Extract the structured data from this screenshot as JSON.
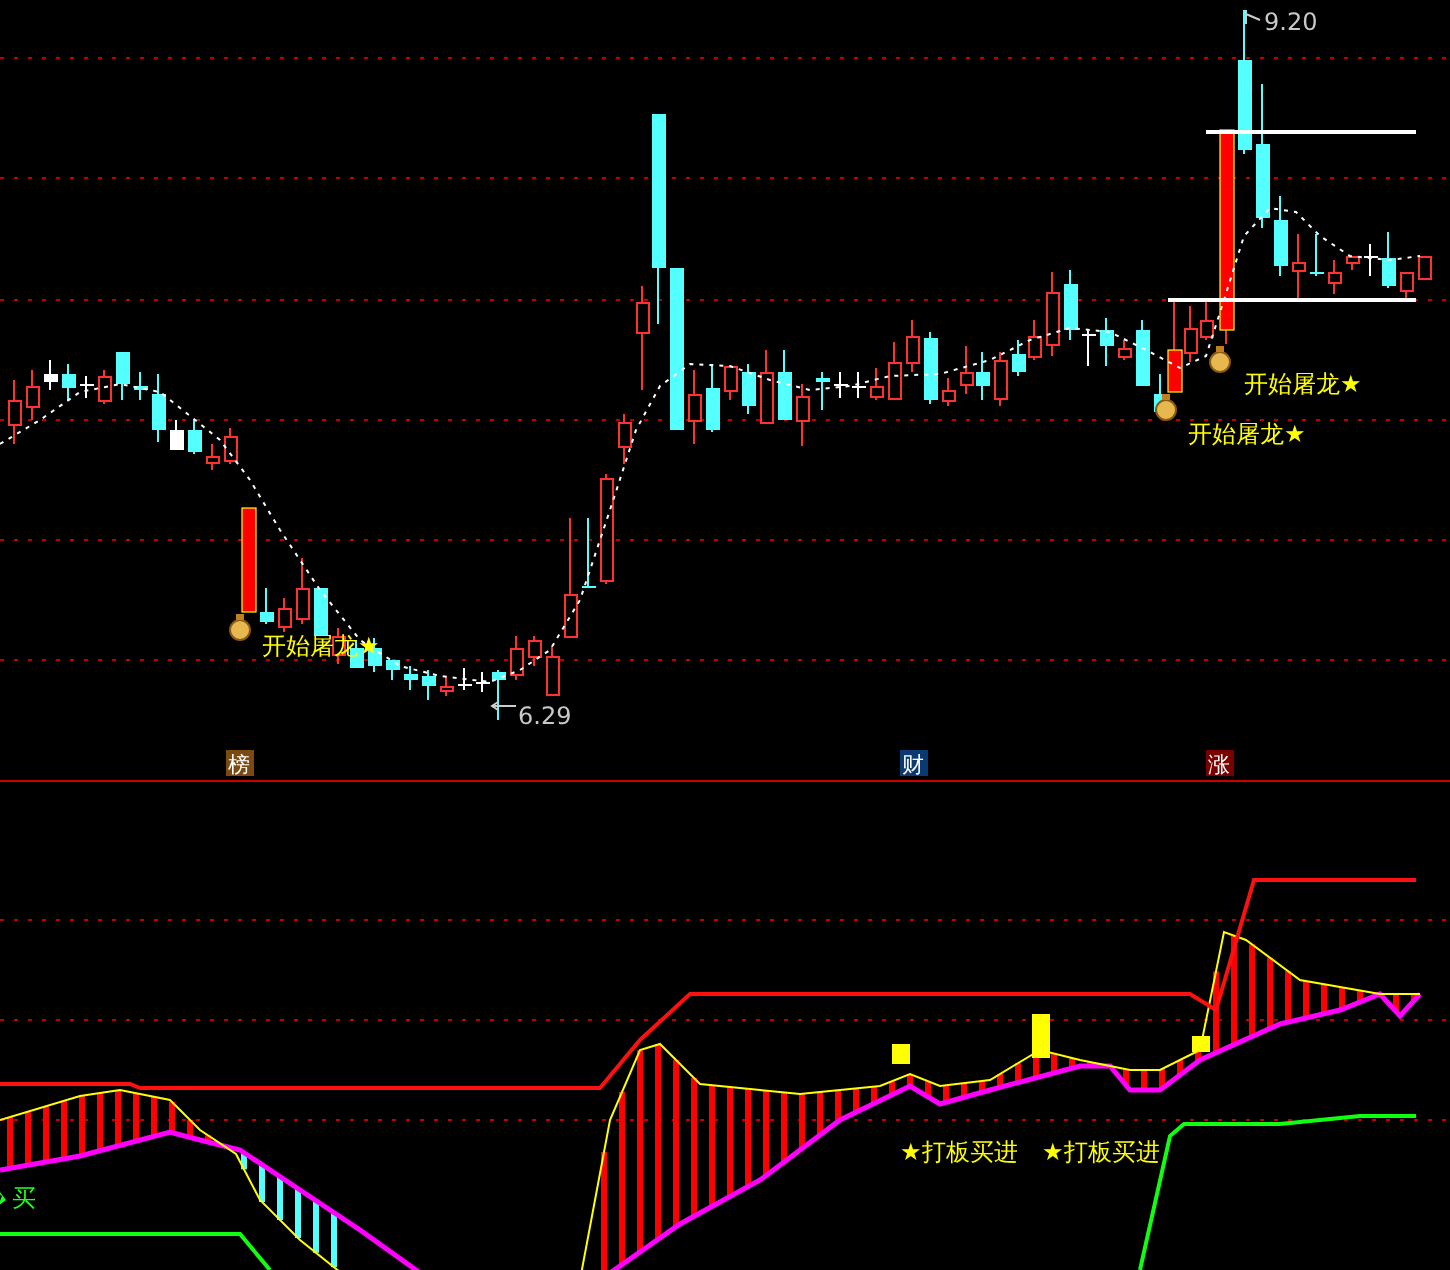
{
  "price_panel": {
    "high_label": "9.20",
    "low_label": "6.29",
    "signals": [
      {
        "text": "开始屠龙★"
      },
      {
        "text": "开始屠龙★"
      },
      {
        "text": "开始屠龙★"
      }
    ]
  },
  "event_markers": [
    {
      "text": "榜",
      "color": "#7a4a10"
    },
    {
      "text": "财",
      "color": "#0b3a73"
    },
    {
      "text": "涨",
      "color": "#7a0000"
    }
  ],
  "indicator_panel": {
    "signals": [
      {
        "text": "★打板买进",
        "kind": "plate"
      },
      {
        "text": "★打板买进",
        "kind": "plate"
      },
      {
        "text": "买",
        "kind": "buy"
      }
    ]
  }
}
